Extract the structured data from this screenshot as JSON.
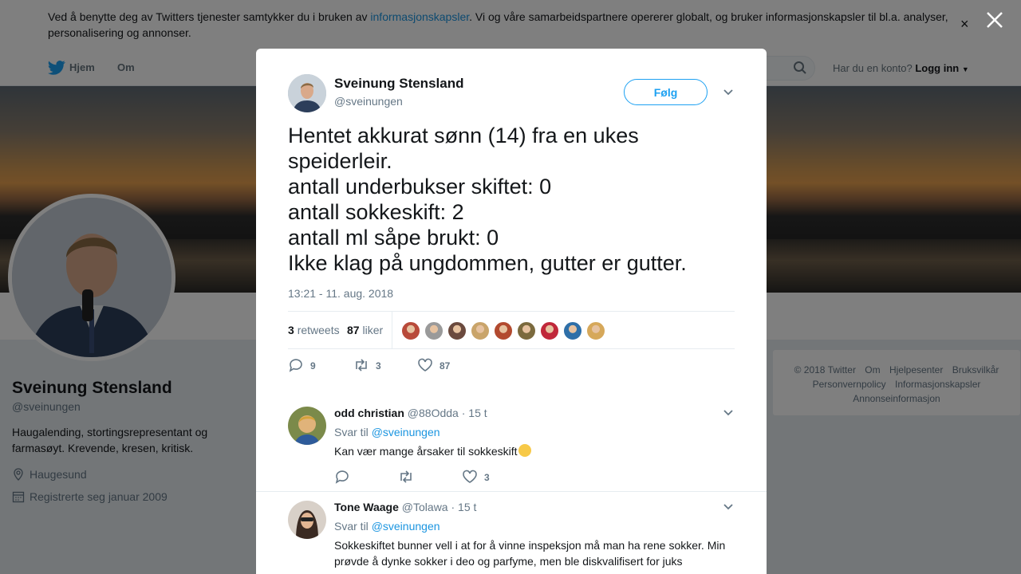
{
  "cookie_banner": {
    "text_before": "Ved å benytte deg av Twitters tjenester samtykker du i bruken av ",
    "link": "informasjonskapsler",
    "text_after": ". Vi og våre samarbeidspartnere opererer globalt, og bruker informasjonskapsler til bl.a. analyser, personalisering og annonser.",
    "close": "×"
  },
  "nav": {
    "home": "Hjem",
    "about": "Om",
    "account_question": "Har du en konto?",
    "login": "Logg inn"
  },
  "profile": {
    "name": "Sveinung Stensland",
    "handle": "@sveinungen",
    "bio": "Haugalending, stortingsrepresentant og farmasøyt. Krevende, kresen, kritisk.",
    "location": "Haugesund",
    "joined": "Registrerte seg januar 2009"
  },
  "footer": {
    "links": [
      "© 2018 Twitter",
      "Om",
      "Hjelpesenter",
      "Bruksvilkår",
      "Personvernpolicy",
      "Informasjonskapsler",
      "Annonseinformasjon"
    ]
  },
  "tweet": {
    "author_name": "Sveinung Stensland",
    "author_handle": "@sveinungen",
    "follow_label": "Følg",
    "lines": [
      "Hentet akkurat sønn (14) fra en ukes",
      "speiderleir.",
      "antall underbukser skiftet: 0",
      "antall sokkeskift: 2",
      "antall ml såpe brukt: 0",
      "Ikke klag på ungdommen, gutter er gutter."
    ],
    "timestamp": "13:21 - 11. aug. 2018",
    "retweets_count": "3",
    "retweets_label": "retweets",
    "likes_count": "87",
    "likes_label": "liker",
    "replies": "9",
    "retweet_action": "3",
    "like_action": "87",
    "liker_colors": [
      "#b84a3a",
      "#9a9a9a",
      "#6b4a3e",
      "#c9a46a",
      "#b24a2f",
      "#7b6a3e",
      "#c0283a",
      "#2e6fa8",
      "#d6a85a"
    ]
  },
  "replies": [
    {
      "name": "odd christian",
      "handle": "@88Odda",
      "time": "· 15 t",
      "reply_to_label": "Svar til",
      "reply_to": "@sveinungen",
      "text": "Kan vær mange årsaker til sokkeskift",
      "like_count": "3"
    },
    {
      "name": "Tone Waage",
      "handle": "@Tolawa",
      "time": "· 15 t",
      "reply_to_label": "Svar til",
      "reply_to": "@sveinungen",
      "text": "Sokkeskiftet bunner vell i at for å vinne inspeksjon må man ha rene sokker. Min prøvde å dynke sokker i deo og parfyme, men ble diskvalifisert for juks"
    }
  ]
}
